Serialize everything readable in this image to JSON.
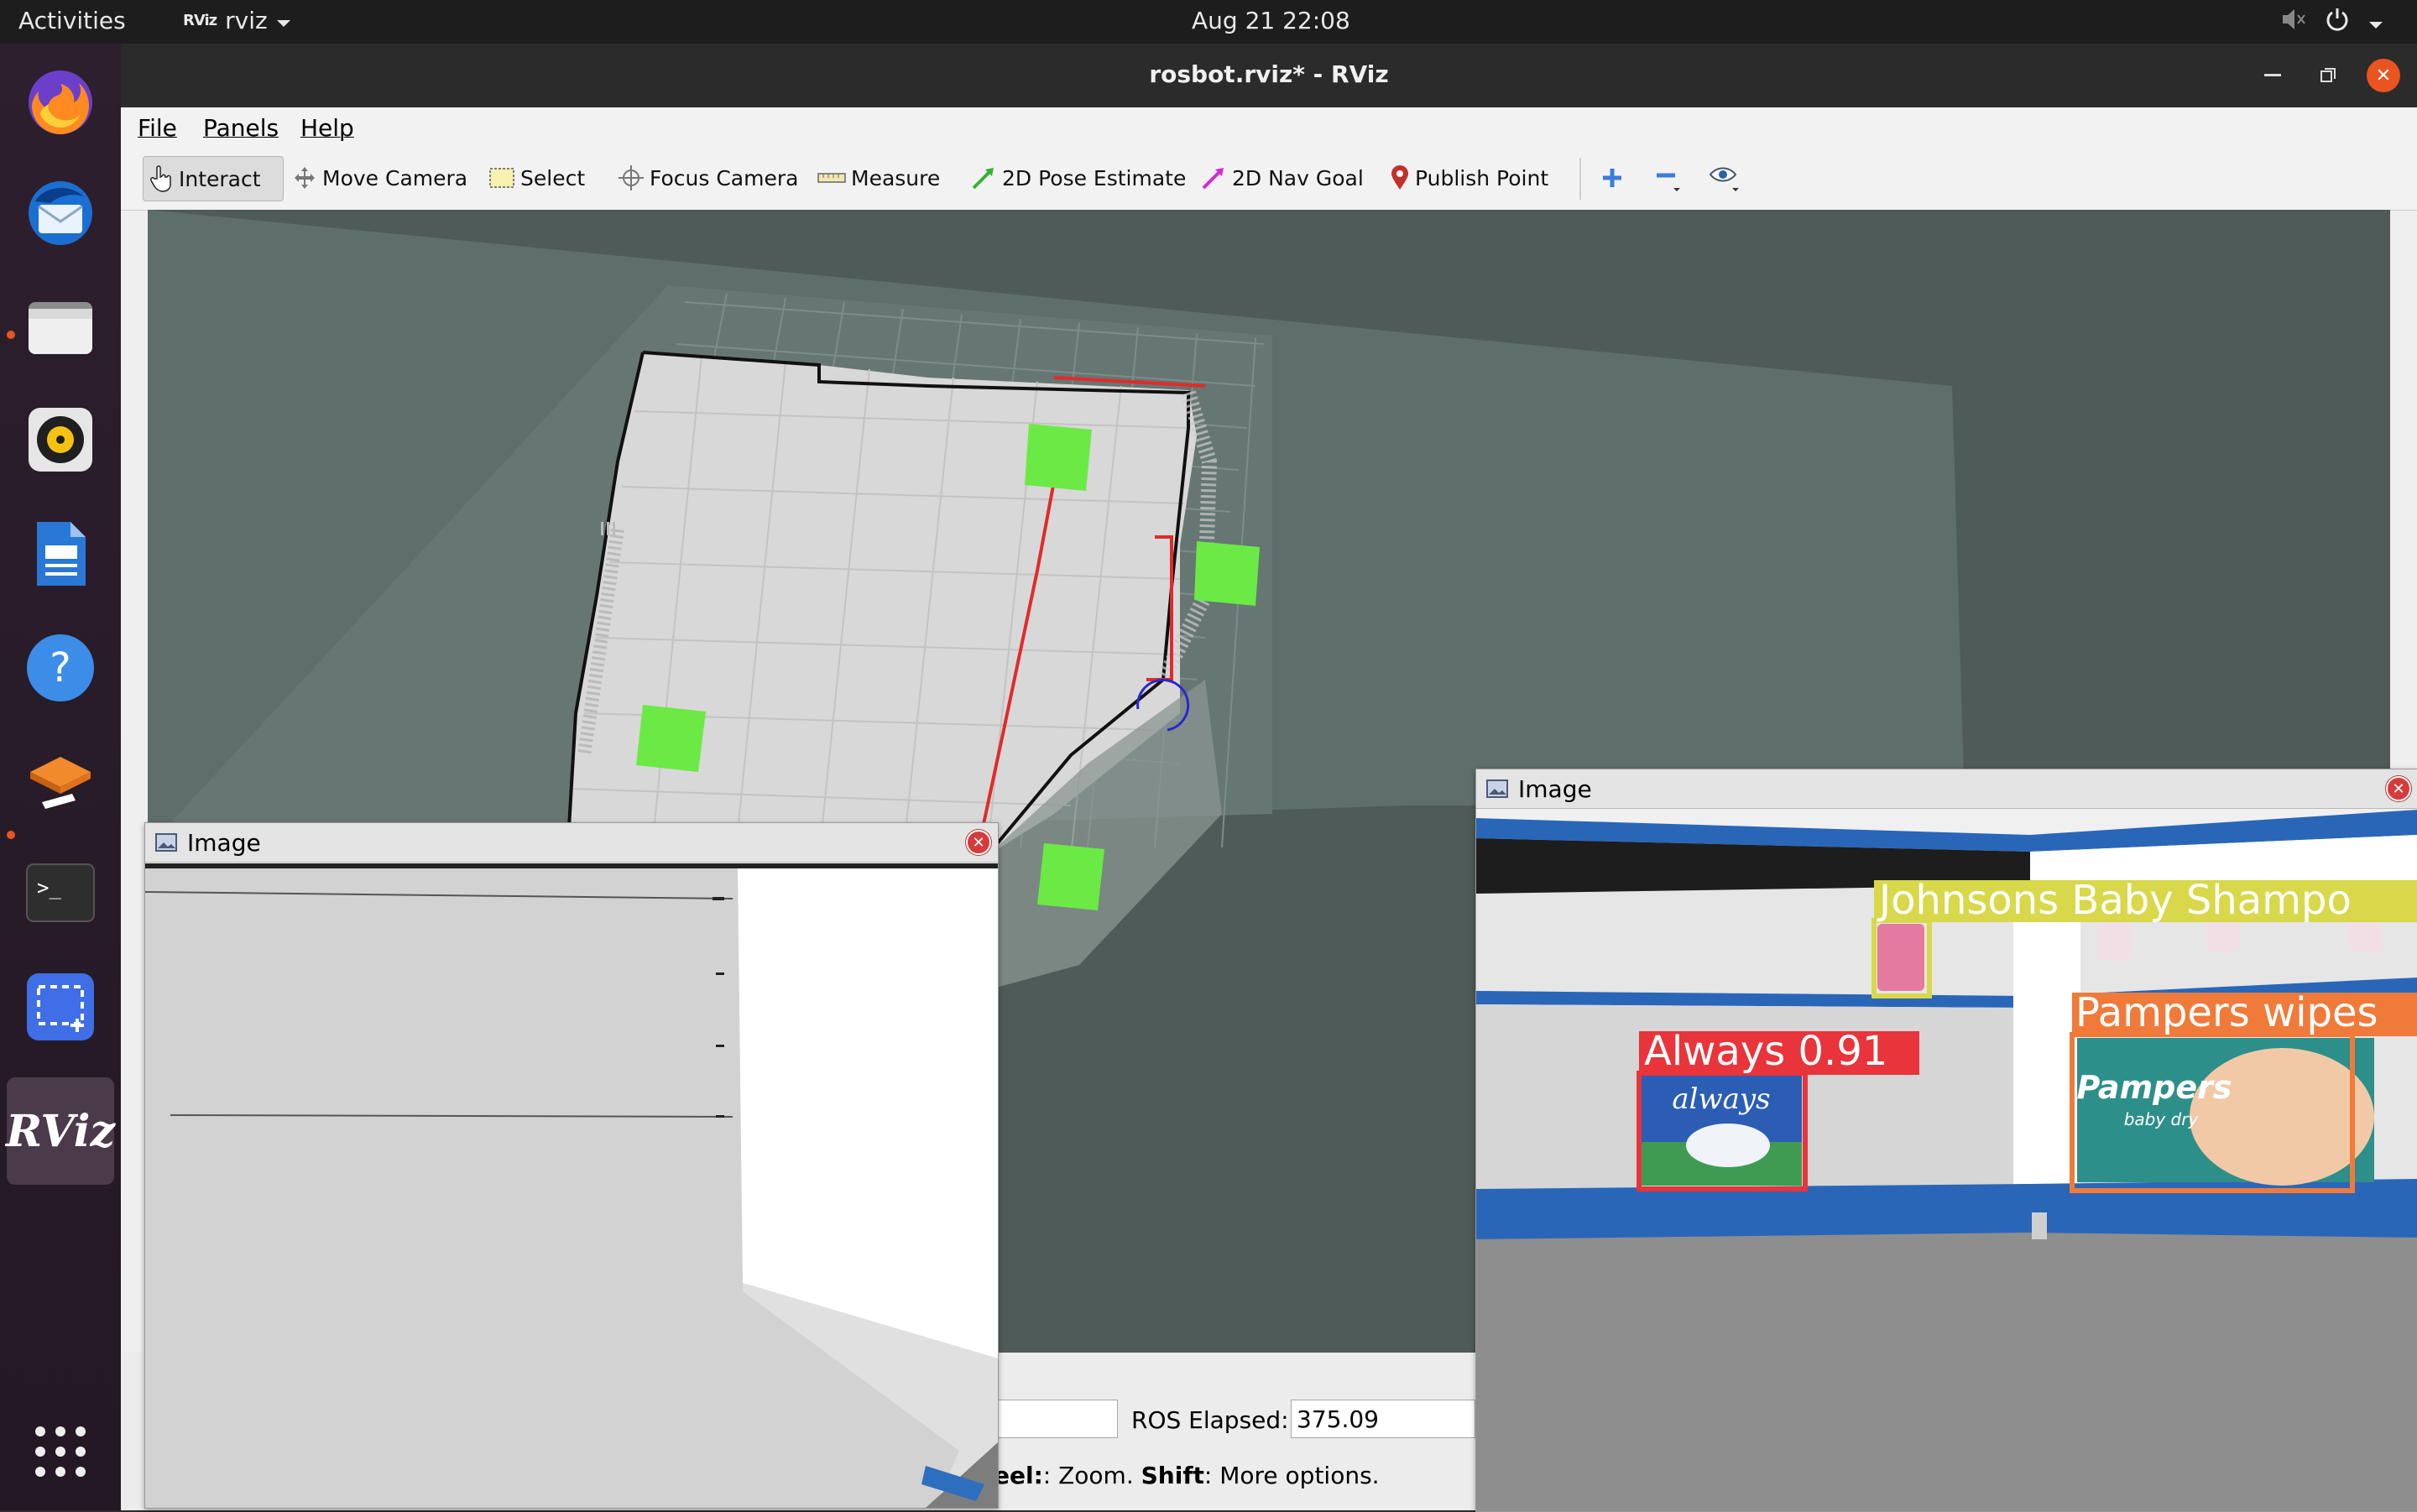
{
  "topbar": {
    "activities": "Activities",
    "app_name": "rviz",
    "app_logo_text": "RViz",
    "clock": "Aug 21  22:08"
  },
  "dock": {
    "items": [
      "firefox-icon",
      "thunderbird-icon",
      "files-icon",
      "rhythmbox-icon",
      "writer-icon",
      "help-icon",
      "ubuntu-software-icon",
      "terminal-icon",
      "screenshot-icon",
      "rviz-icon"
    ],
    "rviz_label": "RViz",
    "terminal_label": ">_"
  },
  "window": {
    "title": "rosbot.rviz* - RViz"
  },
  "menubar": {
    "file": "File",
    "panels": "Panels",
    "help": "Help"
  },
  "toolbar": {
    "interact": "Interact",
    "move_camera": "Move Camera",
    "select": "Select",
    "focus_camera": "Focus Camera",
    "measure": "Measure",
    "pose_estimate": "2D Pose Estimate",
    "nav_goal": "2D Nav Goal",
    "publish_point": "Publish Point"
  },
  "depth_panel": {
    "title": "Image"
  },
  "camera_panel": {
    "title": "Image",
    "detections": [
      {
        "label": "Johnsons Baby Shampo",
        "color": "#d8d84a"
      },
      {
        "label": "Always 0.91",
        "color": "#e8343a"
      },
      {
        "label": "Pampers wipes",
        "color": "#f07a3a"
      }
    ],
    "product_text": {
      "always": "always",
      "pampers": "Pampers",
      "pampers_sub": "baby dry"
    }
  },
  "status": {
    "ros_elapsed_label": "ROS Elapsed:",
    "ros_elapsed_value": "375.09",
    "hint_prefix": "eel:",
    "hint_mid": ": Zoom. ",
    "hint_shift": "Shift",
    "hint_suffix": ": More options."
  },
  "colors": {
    "ubuntu_orange": "#e95420",
    "goal_marker": "#6bea45",
    "path": "#e22a2a",
    "grid_bg": "#5e6e6b"
  }
}
